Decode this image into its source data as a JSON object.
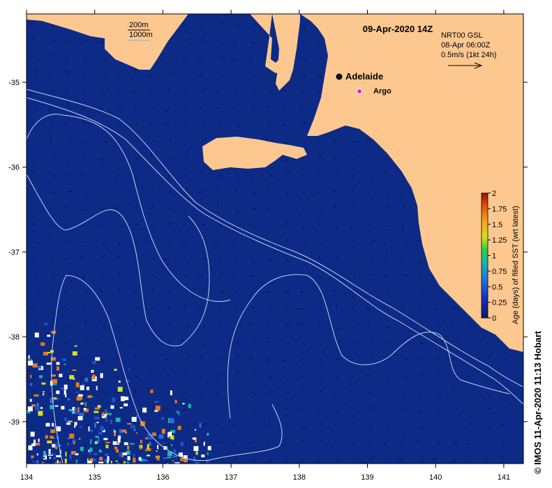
{
  "title": "09-Apr-2020 14Z",
  "overlay": {
    "source": "NRT00 GSL",
    "source_time": "08-Apr 06:00Z",
    "scale_text": "0.5m/s (1kt 24h)"
  },
  "depth_legend": {
    "contour_1": "200m",
    "contour_2": "1000m"
  },
  "places": {
    "city": "Adelaide",
    "float": "Argo"
  },
  "colorbar": {
    "label": "Age (days) of filled SST (wrt latest)",
    "ticks": [
      "0",
      "0.25",
      "0.5",
      "0.75",
      "1",
      "1.25",
      "1.5",
      "1.75",
      "2"
    ]
  },
  "axes": {
    "lon_labels": [
      "134",
      "135",
      "136",
      "137",
      "138",
      "139",
      "140",
      "141"
    ],
    "lat_labels": [
      "-35",
      "-36",
      "-37",
      "-38",
      "-39"
    ]
  },
  "credit": "© IMOS 11-Apr-2020 11:13 Hobart",
  "colors": {
    "ocean": "#0c2a86",
    "land": "#fcc890",
    "contour": "#c8d4f0",
    "gap_white": "#ffffff",
    "age_orange": "#e87a1a",
    "argo_marker": "#e020e0"
  }
}
